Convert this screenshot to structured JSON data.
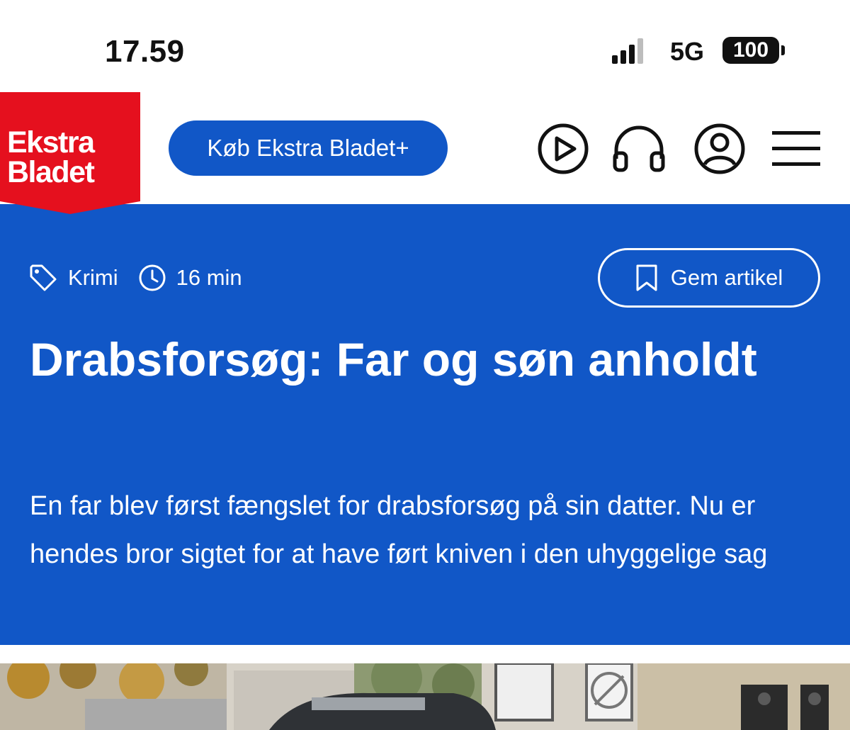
{
  "status_bar": {
    "time": "17.59",
    "network": "5G",
    "battery": "100",
    "icons": [
      "signal-bars-icon",
      "battery-icon"
    ]
  },
  "header": {
    "logo_line1": "Ekstra",
    "logo_line2": "Bladet",
    "buy_button": "Køb Ekstra Bladet+",
    "icons": [
      "play-icon",
      "headphones-icon",
      "user-icon",
      "menu-icon"
    ]
  },
  "article": {
    "category": "Krimi",
    "read_time": "16 min",
    "save_button": "Gem artikel",
    "headline": "Drabsforsøg: Far og søn anholdt",
    "lead": "En far blev først fængslet for drabsforsøg på sin datter. Nu er hendes bror sigtet for at have ført kniven i den uhyggelige sag",
    "icons": [
      "tag-icon",
      "clock-icon",
      "bookmark-icon"
    ]
  },
  "colors": {
    "brand_red": "#e5101e",
    "brand_blue": "#1157c7",
    "text_dark": "#111111"
  }
}
